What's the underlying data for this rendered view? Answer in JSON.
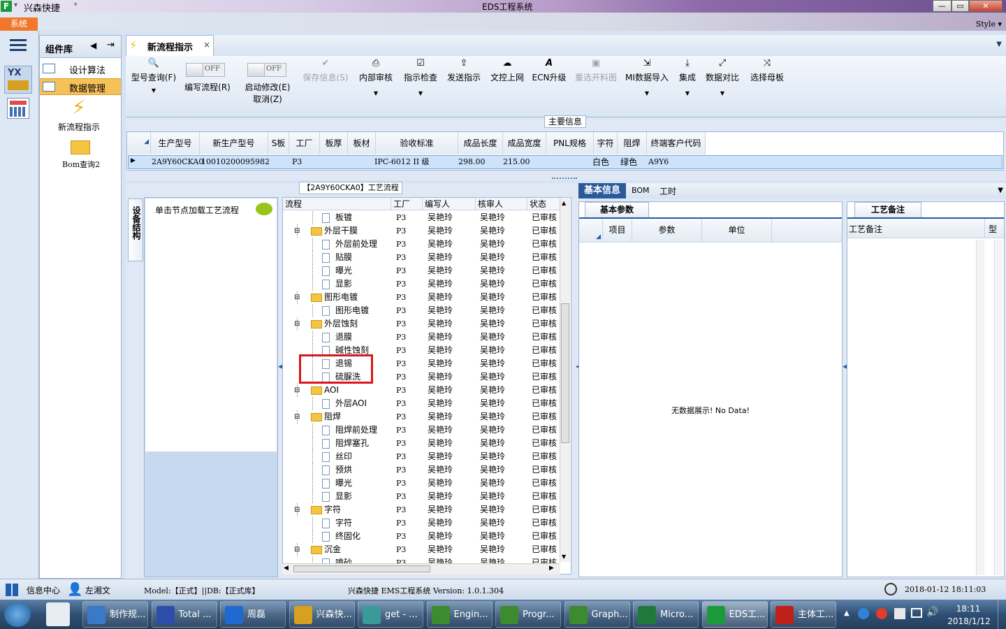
{
  "app": {
    "name": "兴森快捷",
    "window_title": "EDS工程系统",
    "logo_letter": "F"
  },
  "window_controls": {
    "minimize": "—",
    "restore": "▭",
    "close": "✕"
  },
  "menu": {
    "system_button": "系统",
    "style_label": "Style"
  },
  "left_rail": {
    "menu_icon": "hamburger-icon",
    "apps": [
      "yx-factory-icon",
      "calculator-grid-icon"
    ],
    "yx_label": "YX"
  },
  "component_library": {
    "title": "组件库",
    "items": [
      {
        "label": "设计算法",
        "selected": false
      },
      {
        "label": "数据管理",
        "selected": true
      }
    ],
    "big_items": [
      {
        "label": "新流程指示",
        "icon": "lightning-icon"
      },
      {
        "label": "Bom查询2",
        "icon": "folder-open-icon"
      }
    ]
  },
  "doc_tab": {
    "label": "新流程指示",
    "close": "×"
  },
  "ribbon": {
    "buttons": [
      {
        "label": "型号查询(F)",
        "icon": "search-icon",
        "dropdown": true,
        "disabled": false
      },
      {
        "label": "保存信息(S)",
        "icon": "check-icon",
        "dropdown": false,
        "disabled": true
      },
      {
        "label": "内部审核",
        "icon": "printer-icon",
        "dropdown": true,
        "disabled": false
      },
      {
        "label": "指示检查",
        "icon": "checkbox-icon",
        "dropdown": true,
        "disabled": false
      },
      {
        "label": "发送指示",
        "icon": "upload-icon",
        "dropdown": false,
        "disabled": false
      },
      {
        "label": "文控上网",
        "icon": "cloud-upload-icon",
        "dropdown": false,
        "disabled": false
      },
      {
        "label": "ECN升级",
        "icon": "font-icon",
        "dropdown": false,
        "disabled": false
      },
      {
        "label": "重选开料图",
        "icon": "image-icon",
        "dropdown": false,
        "disabled": true
      },
      {
        "label": "MI数据导入",
        "icon": "sign-in-icon",
        "dropdown": true,
        "disabled": false
      },
      {
        "label": "集成",
        "icon": "download-icon",
        "dropdown": true,
        "disabled": false
      },
      {
        "label": "数据对比",
        "icon": "compare-icon",
        "dropdown": true,
        "disabled": false
      },
      {
        "label": "选择母板",
        "icon": "shuffle-icon",
        "dropdown": false,
        "disabled": false
      }
    ],
    "toggles": [
      {
        "label": "编写流程(R)",
        "state": "OFF"
      },
      {
        "label": "启动修改(E)",
        "sub": "取消(Z)",
        "state": "OFF"
      }
    ]
  },
  "main_info": {
    "title": "主要信息",
    "columns": [
      "生产型号",
      "新生产型号",
      "S板",
      "工厂",
      "板厚",
      "板材",
      "验收标准",
      "成品长度",
      "成品宽度",
      "PNL规格",
      "字符",
      "阻焊",
      "终端客户代码"
    ],
    "row": [
      "2A9Y60CKA0",
      "10010200095982",
      "",
      "P3",
      "",
      "",
      "IPC-6012 II 级",
      "298.00",
      "215.00",
      "",
      "白色",
      "绿色",
      "A9Y6"
    ]
  },
  "process_panel": {
    "title": "【2A9Y60CKA0】工艺流程",
    "side_tab": "设备结构",
    "node_hint": "单击节点加载工艺流程",
    "columns": [
      "流程",
      "工厂",
      "编写人",
      "核审人",
      "状态"
    ],
    "rows": [
      {
        "name": "板镀",
        "level": 2,
        "folder": false,
        "factory": "P3",
        "writer": "吴艳玲",
        "reviewer": "吴艳玲",
        "status": "已审核"
      },
      {
        "name": "外层干膜",
        "level": 1,
        "folder": true,
        "factory": "P3",
        "writer": "吴艳玲",
        "reviewer": "吴艳玲",
        "status": "已审核"
      },
      {
        "name": "外层前处理",
        "level": 2,
        "folder": false,
        "factory": "P3",
        "writer": "吴艳玲",
        "reviewer": "吴艳玲",
        "status": "已审核"
      },
      {
        "name": "贴膜",
        "level": 2,
        "folder": false,
        "factory": "P3",
        "writer": "吴艳玲",
        "reviewer": "吴艳玲",
        "status": "已审核"
      },
      {
        "name": "曝光",
        "level": 2,
        "folder": false,
        "factory": "P3",
        "writer": "吴艳玲",
        "reviewer": "吴艳玲",
        "status": "已审核"
      },
      {
        "name": "显影",
        "level": 2,
        "folder": false,
        "factory": "P3",
        "writer": "吴艳玲",
        "reviewer": "吴艳玲",
        "status": "已审核"
      },
      {
        "name": "图形电镀",
        "level": 1,
        "folder": true,
        "factory": "P3",
        "writer": "吴艳玲",
        "reviewer": "吴艳玲",
        "status": "已审核"
      },
      {
        "name": "图形电镀",
        "level": 2,
        "folder": false,
        "factory": "P3",
        "writer": "吴艳玲",
        "reviewer": "吴艳玲",
        "status": "已审核"
      },
      {
        "name": "外层蚀刻",
        "level": 1,
        "folder": true,
        "factory": "P3",
        "writer": "吴艳玲",
        "reviewer": "吴艳玲",
        "status": "已审核"
      },
      {
        "name": "退膜",
        "level": 2,
        "folder": false,
        "factory": "P3",
        "writer": "吴艳玲",
        "reviewer": "吴艳玲",
        "status": "已审核"
      },
      {
        "name": "碱性蚀刻",
        "level": 2,
        "folder": false,
        "factory": "P3",
        "writer": "吴艳玲",
        "reviewer": "吴艳玲",
        "status": "已审核"
      },
      {
        "name": "退锡",
        "level": 2,
        "folder": false,
        "factory": "P3",
        "writer": "吴艳玲",
        "reviewer": "吴艳玲",
        "status": "已审核"
      },
      {
        "name": "硫脲洗",
        "level": 2,
        "folder": false,
        "factory": "P3",
        "writer": "吴艳玲",
        "reviewer": "吴艳玲",
        "status": "已审核"
      },
      {
        "name": "AOI",
        "level": 1,
        "folder": true,
        "factory": "P3",
        "writer": "吴艳玲",
        "reviewer": "吴艳玲",
        "status": "已审核"
      },
      {
        "name": "外层AOI",
        "level": 2,
        "folder": false,
        "factory": "P3",
        "writer": "吴艳玲",
        "reviewer": "吴艳玲",
        "status": "已审核"
      },
      {
        "name": "阻焊",
        "level": 1,
        "folder": true,
        "factory": "P3",
        "writer": "吴艳玲",
        "reviewer": "吴艳玲",
        "status": "已审核"
      },
      {
        "name": "阻焊前处理",
        "level": 2,
        "folder": false,
        "factory": "P3",
        "writer": "吴艳玲",
        "reviewer": "吴艳玲",
        "status": "已审核"
      },
      {
        "name": "阻焊塞孔",
        "level": 2,
        "folder": false,
        "factory": "P3",
        "writer": "吴艳玲",
        "reviewer": "吴艳玲",
        "status": "已审核"
      },
      {
        "name": "丝印",
        "level": 2,
        "folder": false,
        "factory": "P3",
        "writer": "吴艳玲",
        "reviewer": "吴艳玲",
        "status": "已审核"
      },
      {
        "name": "预烘",
        "level": 2,
        "folder": false,
        "factory": "P3",
        "writer": "吴艳玲",
        "reviewer": "吴艳玲",
        "status": "已审核"
      },
      {
        "name": "曝光",
        "level": 2,
        "folder": false,
        "factory": "P3",
        "writer": "吴艳玲",
        "reviewer": "吴艳玲",
        "status": "已审核"
      },
      {
        "name": "显影",
        "level": 2,
        "folder": false,
        "factory": "P3",
        "writer": "吴艳玲",
        "reviewer": "吴艳玲",
        "status": "已审核"
      },
      {
        "name": "字符",
        "level": 1,
        "folder": true,
        "factory": "P3",
        "writer": "吴艳玲",
        "reviewer": "吴艳玲",
        "status": "已审核"
      },
      {
        "name": "字符",
        "level": 2,
        "folder": false,
        "factory": "P3",
        "writer": "吴艳玲",
        "reviewer": "吴艳玲",
        "status": "已审核"
      },
      {
        "name": "终固化",
        "level": 2,
        "folder": false,
        "factory": "P3",
        "writer": "吴艳玲",
        "reviewer": "吴艳玲",
        "status": "已审核"
      },
      {
        "name": "沉金",
        "level": 1,
        "folder": true,
        "factory": "P3",
        "writer": "吴艳玲",
        "reviewer": "吴艳玲",
        "status": "已审核"
      },
      {
        "name": "喷砂",
        "level": 2,
        "folder": false,
        "factory": "P3",
        "writer": "吴艳玲",
        "reviewer": "吴艳玲",
        "status": "已审核"
      }
    ],
    "highlight_color": "#d9161b"
  },
  "right_tabs": [
    "基本信息",
    "BOM",
    "工时"
  ],
  "basic_params": {
    "title": "基本参数",
    "columns": [
      "项目",
      "参数",
      "单位"
    ],
    "empty": "无数据展示! No Data!"
  },
  "process_notes": {
    "title": "工艺备注",
    "columns": [
      "工艺备注",
      "型"
    ]
  },
  "status_bar": {
    "info_center": "信息中心",
    "user": "左湘文",
    "model": "Model:【正式】||DB:【正式库】",
    "product": "兴森快捷 EMS工程系统 Version: 1.0.1.304",
    "datetime": "2018-01-12 18:11:03"
  },
  "taskbar": {
    "items": [
      {
        "label": "制作规...",
        "color": "#3a78c8"
      },
      {
        "label": "Total ...",
        "color": "#2d4ea8"
      },
      {
        "label": "周磊",
        "color": "#1f6ad0"
      },
      {
        "label": "兴森快...",
        "color": "#d8a020"
      },
      {
        "label": "get - ...",
        "color": "#3a9a9a"
      },
      {
        "label": "Engin...",
        "color": "#3c8b2f"
      },
      {
        "label": "Progr...",
        "color": "#3c8b2f"
      },
      {
        "label": "Graph...",
        "color": "#3c8b2f"
      },
      {
        "label": "Micro...",
        "color": "#1f7a3a"
      },
      {
        "label": "EDS工...",
        "color": "#1a9a3a"
      },
      {
        "label": "主体工...",
        "color": "#c0201a"
      }
    ],
    "time": "18:11",
    "date": "2018/1/12"
  }
}
